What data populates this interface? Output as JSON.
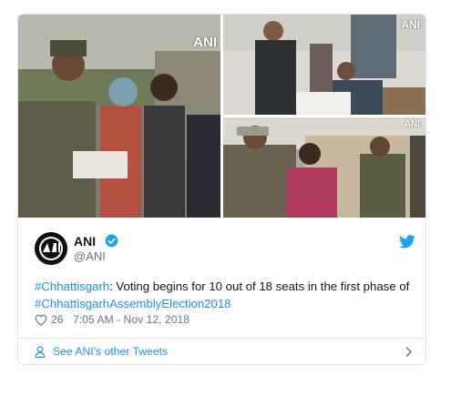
{
  "tweet": {
    "display_name": "ANI",
    "handle": "@ANI",
    "text": {
      "hashtag1": "#Chhattisgarh",
      "middle": ": Voting begins for 10 out of 18 seats in the first phase of ",
      "hashtag2": "#ChhattisgarhAssemblyElection2018"
    },
    "likes": "26",
    "timestamp": "7:05 AM - Nov 12, 2018",
    "see_more": "See ANI's other Tweets"
  },
  "media": {
    "watermark_1": "ANI",
    "watermark_2": "ANI",
    "watermark_3": "ANI"
  },
  "colors": {
    "link": "#1b95e0",
    "muted": "#657786",
    "border": "#e1e8ed"
  },
  "icons": [
    "verified-badge-icon",
    "twitter-bird-icon",
    "heart-icon",
    "person-icon",
    "chevron-right-icon"
  ]
}
